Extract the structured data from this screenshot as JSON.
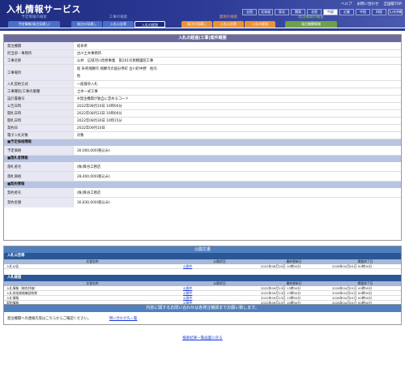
{
  "header": {
    "title": "入札情報サービス",
    "links": [
      "ヘルプ",
      "お問い合わせ",
      "全国版TOP"
    ],
    "regions": [
      "全国",
      "北海道",
      "東北",
      "関東",
      "北陸",
      "中部",
      "近畿",
      "中国",
      "四国",
      "九州沖縄"
    ]
  },
  "nav": {
    "groups": [
      {
        "title": "予定情報の検索",
        "tabs": [
          "予定情報(発注見通し)"
        ]
      },
      {
        "title": "工事の検索",
        "tabs": [
          "発注の見通し",
          "入札公告等",
          "入札の経過"
        ]
      },
      {
        "title": "業務の検索",
        "tabs": [
          "発注の見通し",
          "入札公告等",
          "入札の経過"
        ]
      },
      {
        "title": "発注機関の検索",
        "tabs": [
          "発注機関情報"
        ]
      }
    ]
  },
  "main": {
    "title": "入札の経過(工事)案件概要",
    "rows": [
      {
        "label": "発注機関",
        "value": "岐阜県"
      },
      {
        "label": "担当部・事務所",
        "value": "古川土木事務所"
      },
      {
        "label": "工事名称",
        "value": "公共　広域河川改修事業　第201号修繕舗装工事"
      },
      {
        "label": "工事場所",
        "value": "岐 阜県飛騨市 飛騨市の国分寺町 古川町中野　他内"
      }
    ],
    "row_extra": "他",
    "rows2": [
      {
        "label": "入札契約方式",
        "value": "一般競争入札"
      },
      {
        "label": "工事種別/工事の業種",
        "value": "土木一式工事"
      },
      {
        "label": "設計書番号",
        "value": "※発注機関が独自に定めるコード"
      },
      {
        "label": "公告日時",
        "value": "2022年08月10日 10時00分"
      },
      {
        "label": "開札日時",
        "value": "2022年08月23日 10時00分"
      },
      {
        "label": "開札日時",
        "value": "2022年08月30日 10時15分"
      },
      {
        "label": "契約日",
        "value": "2022年09月10日"
      },
      {
        "label": "電子入札対象",
        "value": "対象"
      }
    ],
    "section_estimate": "■予定価格情報",
    "estimate": [
      {
        "label": "予定価格",
        "value": "30,000,000(税込み)"
      }
    ],
    "section_winner": "■落札者情報",
    "winner": [
      {
        "label": "落札者名",
        "value": "(株)箕谷工務店"
      },
      {
        "label": "落札価格",
        "value": "28,400,000(税込み)"
      }
    ],
    "section_contract": "■契約情報",
    "contract": [
      {
        "label": "契約者名",
        "value": "(株)箕谷工務店"
      },
      {
        "label": "契約金額",
        "value": "30,830,000(税込み)"
      }
    ]
  },
  "publication": {
    "title": "公開文書",
    "sections": [
      {
        "name": "入札公告等",
        "columns": [
          "文書名称",
          "公開状況",
          "最終更新日",
          "掲載終了日"
        ],
        "rows": [
          {
            "name": "入札公告",
            "status": "公開中",
            "updated": "2022年08月10日 10時00分",
            "end": "2026年04月01日 00時00分"
          }
        ]
      },
      {
        "name": "入札経過",
        "columns": [
          "文書名称",
          "公開状況",
          "最終更新日",
          "掲載終了日"
        ],
        "rows": [
          {
            "name": "入札情報（総合評価）",
            "status": "公開中",
            "updated": "2022年09月13日 13時00分",
            "end": "2026年04月01日 00時00分"
          },
          {
            "name": "入札参加資格確認結果",
            "status": "公開中",
            "updated": "2022年09月13日 13時00分",
            "end": "2026年04月01日 00時00分"
          },
          {
            "name": "入札情報",
            "status": "公開中",
            "updated": "2022年09月13日 13時00分",
            "end": "2026年04月01日 00時00分"
          },
          {
            "name": "契約情報",
            "status": "公開中",
            "updated": "2022年09月23日 10時00分",
            "end": "2026年04月01日 00時00分"
          }
        ]
      }
    ]
  },
  "contact": {
    "title": "内容に関するお問い合わせは各発注機関までお願い致します。",
    "text": "発注機関への連絡先等はこちらからご確認ください。",
    "link": "問い合わせ先一覧"
  },
  "back_link": "検索結果一覧画面に戻る",
  "colors": {
    "header": "#1d2b80",
    "tab_blue": "#4a6fc7",
    "tab_orange": "#e8943a",
    "tab_green": "#6fa04a",
    "tab_active": "#1d2b80"
  }
}
